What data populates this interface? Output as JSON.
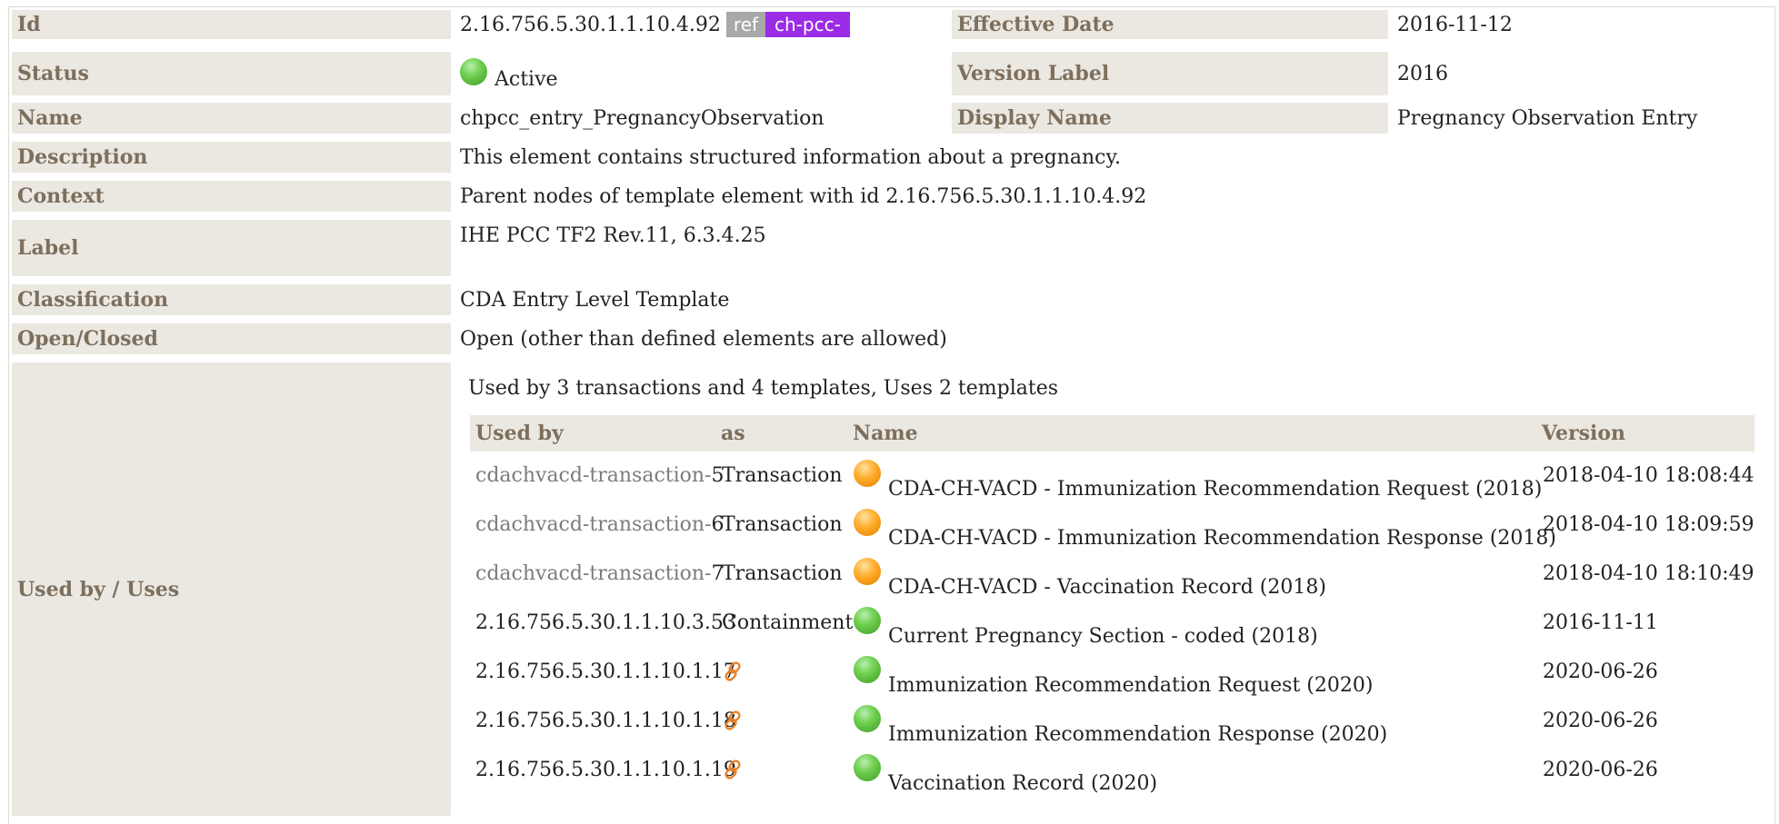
{
  "meta": {
    "id": {
      "label": "Id",
      "value": "2.16.756.5.30.1.1.10.4.92",
      "tag_ref": "ref",
      "tag_prefix": "ch-pcc-"
    },
    "effective_date": {
      "label": "Effective Date",
      "value": "2016-11-12"
    },
    "status": {
      "label": "Status",
      "value": "Active",
      "indicator": "green-status-dot"
    },
    "version_label": {
      "label": "Version Label",
      "value": "2016"
    },
    "name": {
      "label": "Name",
      "value": "chpcc_entry_PregnancyObservation"
    },
    "display_name": {
      "label": "Display Name",
      "value": "Pregnancy Observation Entry"
    },
    "description": {
      "label": "Description",
      "value": "This element contains structured information about a pregnancy."
    },
    "context": {
      "label": "Context",
      "value": "Parent nodes of template element with id 2.16.756.5.30.1.1.10.4.92"
    },
    "label": {
      "label": "Label",
      "value": "IHE PCC TF2 Rev.11, 6.3.4.25"
    },
    "classification": {
      "label": "Classification",
      "value": "CDA Entry Level Template"
    },
    "open_closed": {
      "label": "Open/Closed",
      "value": "Open (other than defined elements are allowed)"
    }
  },
  "usage": {
    "label": "Used by / Uses",
    "summary": "Used by 3 transactions and 4 templates, Uses 2 templates",
    "columns": [
      "Used by",
      "as",
      "Name",
      "Version"
    ],
    "rows": [
      {
        "ref_prefix": "cdachvacd-transaction-",
        "ref_suffix": "5",
        "as": "Transaction",
        "status": "orange",
        "name": "CDA-CH-VACD - Immunization Recommendation Request (2018)",
        "version": "2018-04-10 18:08:44"
      },
      {
        "ref_prefix": "cdachvacd-transaction-",
        "ref_suffix": "6",
        "as": "Transaction",
        "status": "orange",
        "name": "CDA-CH-VACD - Immunization Recommendation Response (2018)",
        "version": "2018-04-10 18:09:59"
      },
      {
        "ref_prefix": "cdachvacd-transaction-",
        "ref_suffix": "7",
        "as": "Transaction",
        "status": "orange",
        "name": "CDA-CH-VACD - Vaccination Record (2018)",
        "version": "2018-04-10 18:10:49"
      },
      {
        "ref_prefix": "",
        "ref_suffix": "2.16.756.5.30.1.1.10.3.53",
        "as": "Containment",
        "status": "green",
        "name": "Current Pregnancy Section - coded (2018)",
        "version": "2016-11-11"
      },
      {
        "ref_prefix": "",
        "ref_suffix": "2.16.756.5.30.1.1.10.1.17",
        "as": "",
        "as_icon": "chain-link-icon",
        "status": "green",
        "name": "Immunization Recommendation Request (2020)",
        "version": "2020-06-26"
      },
      {
        "ref_prefix": "",
        "ref_suffix": "2.16.756.5.30.1.1.10.1.18",
        "as": "",
        "as_icon": "chain-link-icon",
        "status": "green",
        "name": "Immunization Recommendation Response (2020)",
        "version": "2020-06-26"
      },
      {
        "ref_prefix": "",
        "ref_suffix": "2.16.756.5.30.1.1.10.1.19",
        "as": "",
        "as_icon": "chain-link-icon",
        "status": "green",
        "name": "Vaccination Record (2020)",
        "version": "2020-06-26"
      }
    ]
  },
  "colors": {
    "label_bg": "#ebe8e2",
    "label_text": "#7d6f5d",
    "tag_prefix": "#9b2ce6",
    "tag_ref": "#a8a8a8",
    "status_green": "#4caf2f",
    "status_orange": "#f59c1a"
  }
}
